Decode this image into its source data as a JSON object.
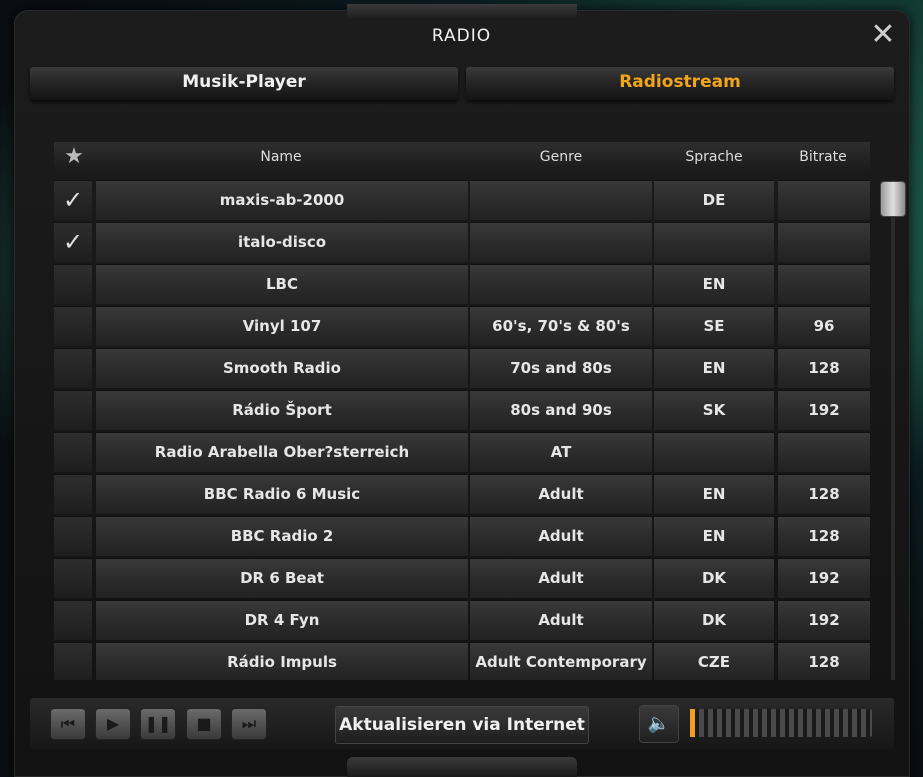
{
  "window": {
    "title": "RADIO"
  },
  "tabs": {
    "musik_player": "Musik-Player",
    "radiostream": "Radiostream",
    "active_color": "#f2a51b"
  },
  "table": {
    "headers": {
      "name": "Name",
      "genre": "Genre",
      "sprache": "Sprache",
      "bitrate": "Bitrate"
    },
    "rows": [
      {
        "checked": true,
        "name": "maxis-ab-2000",
        "genre": "",
        "sprache": "DE",
        "bitrate": ""
      },
      {
        "checked": true,
        "name": "italo-disco",
        "genre": "",
        "sprache": "",
        "bitrate": ""
      },
      {
        "checked": false,
        "name": "LBC",
        "genre": "",
        "sprache": "EN",
        "bitrate": ""
      },
      {
        "checked": false,
        "name": "Vinyl 107",
        "genre": "60's, 70's & 80's",
        "sprache": "SE",
        "bitrate": "96"
      },
      {
        "checked": false,
        "name": "Smooth Radio",
        "genre": "70s and 80s",
        "sprache": "EN",
        "bitrate": "128"
      },
      {
        "checked": false,
        "name": "Rádio Šport",
        "genre": "80s and 90s",
        "sprache": "SK",
        "bitrate": "192"
      },
      {
        "checked": false,
        "name": "Radio Arabella Ober?sterreich",
        "genre": "AT",
        "sprache": "",
        "bitrate": ""
      },
      {
        "checked": false,
        "name": "BBC Radio 6 Music",
        "genre": "Adult",
        "sprache": "EN",
        "bitrate": "128"
      },
      {
        "checked": false,
        "name": "BBC Radio 2",
        "genre": "Adult",
        "sprache": "EN",
        "bitrate": "128"
      },
      {
        "checked": false,
        "name": "DR 6 Beat",
        "genre": "Adult",
        "sprache": "DK",
        "bitrate": "192"
      },
      {
        "checked": false,
        "name": "DR 4 Fyn",
        "genre": "Adult",
        "sprache": "DK",
        "bitrate": "192"
      },
      {
        "checked": false,
        "name": "Rádio Impuls",
        "genre": "Adult Contemporary",
        "sprache": "CZE",
        "bitrate": "128"
      }
    ]
  },
  "controls": {
    "update_label": "Aktualisieren via Internet",
    "volume_level": 0.05,
    "icons": [
      "skip-back-icon",
      "play-icon",
      "pause-icon",
      "stop-icon",
      "skip-forward-icon",
      "speaker-icon"
    ]
  }
}
